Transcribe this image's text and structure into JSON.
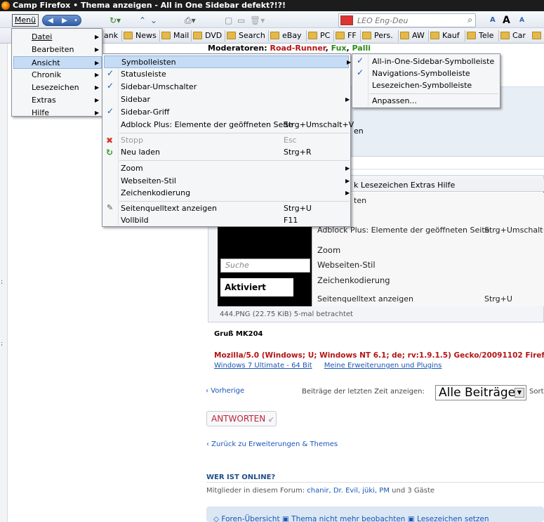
{
  "window": {
    "title": "Camp Firefox • Thema anzeigen - All in One Sidebar defekt?!?!"
  },
  "toolbar": {
    "menu_label": "Menü",
    "search_placeholder": "LEO Eng-Deu",
    "zoom_a_small": "A",
    "zoom_a_big": "A",
    "zoom_a_tiny": "A"
  },
  "bookmarks": [
    {
      "label": "ank"
    },
    {
      "label": "News"
    },
    {
      "label": "Mail"
    },
    {
      "label": "DVD"
    },
    {
      "label": "Search"
    },
    {
      "label": "eBay"
    },
    {
      "label": "PC"
    },
    {
      "label": "FF"
    },
    {
      "label": "Pers."
    },
    {
      "label": "AW"
    },
    {
      "label": "Kauf"
    },
    {
      "label": "Tele"
    },
    {
      "label": "Car"
    }
  ],
  "menu_main": [
    {
      "label": "Datei"
    },
    {
      "label": "Bearbeiten"
    },
    {
      "label": "Ansicht"
    },
    {
      "label": "Chronik"
    },
    {
      "label": "Lesezeichen"
    },
    {
      "label": "Extras"
    },
    {
      "label": "Hilfe"
    }
  ],
  "menu_ansicht": [
    {
      "label": "Symbolleisten",
      "accel": ""
    },
    {
      "label": "Statusleiste",
      "accel": ""
    },
    {
      "label": "Sidebar-Umschalter",
      "accel": ""
    },
    {
      "label": "Sidebar",
      "accel": ""
    },
    {
      "label": "Sidebar-Griff",
      "accel": ""
    },
    {
      "label": "Adblock Plus: Elemente der geöffneten Seite",
      "accel": "Strg+Umschalt+V"
    },
    {
      "label": "Stopp",
      "accel": "Esc"
    },
    {
      "label": "Neu laden",
      "accel": "Strg+R"
    },
    {
      "label": "Zoom",
      "accel": ""
    },
    {
      "label": "Webseiten-Stil",
      "accel": ""
    },
    {
      "label": "Zeichenkodierung",
      "accel": ""
    },
    {
      "label": "Seitenquelltext anzeigen",
      "accel": "Strg+U"
    },
    {
      "label": "Vollbild",
      "accel": "F11"
    }
  ],
  "menu_symbolleisten": [
    {
      "label": "All-in-One-Sidebar-Symbolleiste"
    },
    {
      "label": "Navigations-Symbolleiste"
    },
    {
      "label": "Lesezeichen-Symbolleiste"
    },
    {
      "label": "Anpassen..."
    }
  ],
  "page": {
    "moderators_label": "Moderatoren:",
    "mod1": "Road-Runner",
    "mod2": "Fux",
    "mod3": "Palli",
    "post_fragment": "en",
    "ss_menubar": "k  Lesezeichen  Extras  Hilfe",
    "ss_row_ten": "ten",
    "ss_adblock": "Adblock Plus: Elemente der geöffneten Seite",
    "ss_adblock_accel": "Strg+Umschalt+",
    "ss_zoom": "Zoom",
    "ss_webstil": "Webseiten-Stil",
    "ss_zeichen": "Zeichenkodierung",
    "ss_quelltext": "Seitenquelltext anzeigen",
    "ss_quelltext_accel": "Strg+U",
    "ss_suche": "Suche",
    "ss_aktiviert": "Aktiviert",
    "caption": "444.PNG (22.75 KiB) 5-mal betrachtet",
    "gruss": "Gruß MK204",
    "useragent": "Mozilla/5.0 (Windows; U; Windows NT 6.1; de; rv:1.9.1.5) Gecko/20091102 Firefo",
    "sig_link1": "Windows 7 Ultimate - 64 Bit",
    "sig_link2": "Meine Erweiterungen und Plugins",
    "vorherige": "‹ Vorherige",
    "beitraege_label": "Beiträge der letzten Zeit anzeigen:",
    "beitraege_value": "Alle Beiträge",
    "sort_label": "Sort",
    "antworten": "ANTWORTEN",
    "zurueck": "‹ Zurück zu Erweiterungen & Themes",
    "wer_ist_online": "WER IST ONLINE?",
    "mitglieder_prefix": "Mitglieder in diesem Forum:",
    "mitglieder_users": "chanir, Dr. Evil, jüki, PM",
    "mitglieder_suffix": "und 3 Gäste",
    "footer_items": "Foren-Übersicht   ▣ Thema nicht mehr beobachten   ▣ Lesezeichen setzen"
  }
}
